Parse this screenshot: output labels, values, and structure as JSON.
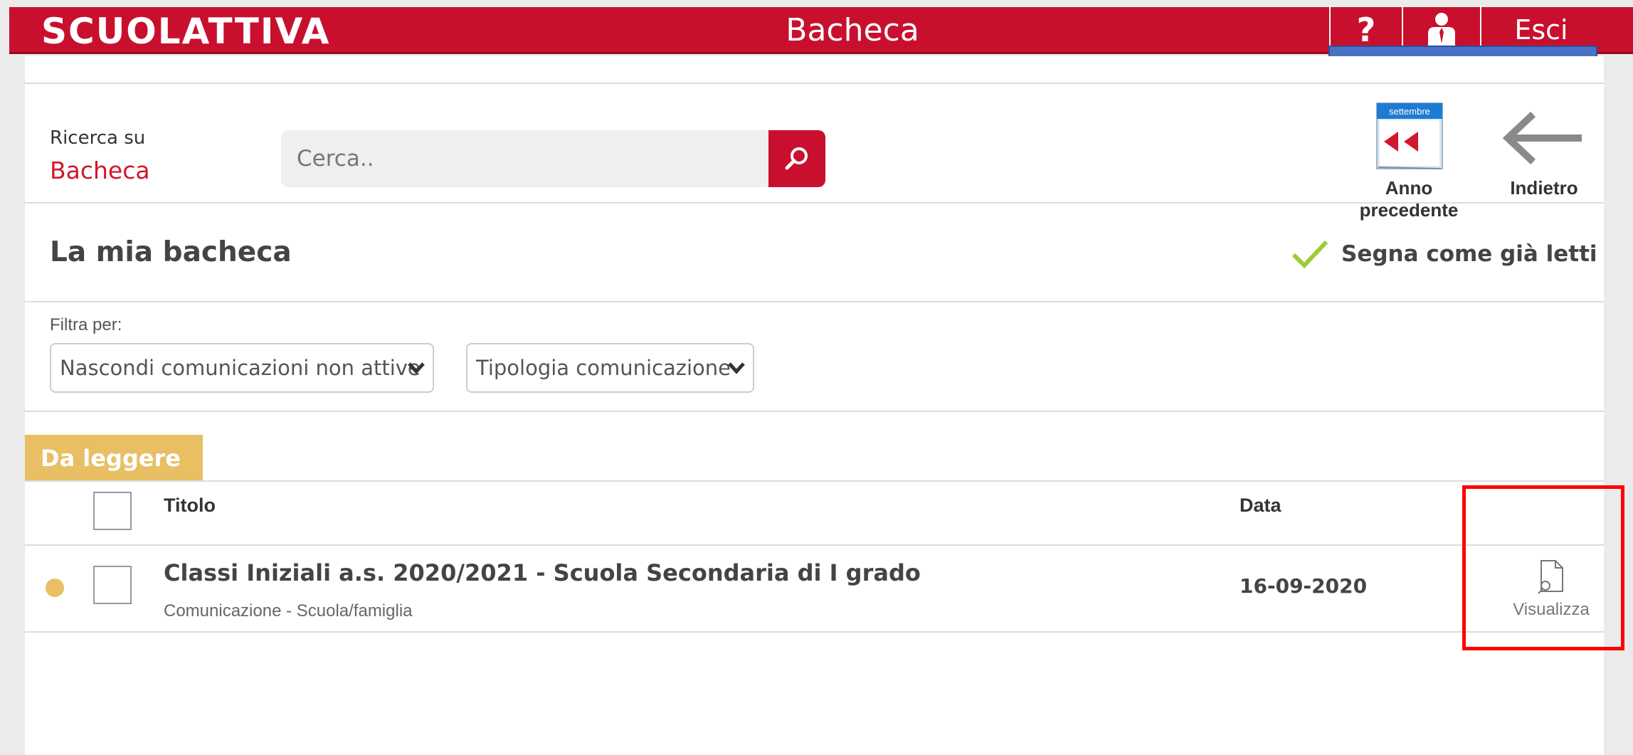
{
  "header": {
    "logo": "SCUOLATTIVA",
    "title": "Bacheca",
    "help_label": "?",
    "logout_label": "Esci"
  },
  "search": {
    "label_small": "Ricerca su",
    "label_big": "Bacheca",
    "placeholder": "Cerca.."
  },
  "toolbar": {
    "calendar_month": "settembre",
    "prev_year_label": "Anno precedente",
    "back_label": "Indietro"
  },
  "board": {
    "title": "La mia bacheca",
    "mark_read_label": "Segna come già letti"
  },
  "filters": {
    "label": "Filtra per:",
    "visibility_selected": "Nascondi comunicazioni non attive",
    "type_selected": "Tipologia comunicazione"
  },
  "tabs": {
    "to_read": "Da leggere"
  },
  "table": {
    "columns": {
      "title": "Titolo",
      "date": "Data"
    },
    "rows": [
      {
        "title": "Classi Iniziali a.s. 2020/2021 - Scuola Secondaria di I grado",
        "subtitle": "Comunicazione - Scuola/famiglia",
        "date": "16-09-2020",
        "action_label": "Visualizza"
      }
    ]
  },
  "colors": {
    "brand_red": "#c8102e",
    "tab_yellow": "#e8bf63",
    "check_green": "#9acd32",
    "highlight_red": "#ff0000",
    "blue_bar": "#4a72c4"
  }
}
